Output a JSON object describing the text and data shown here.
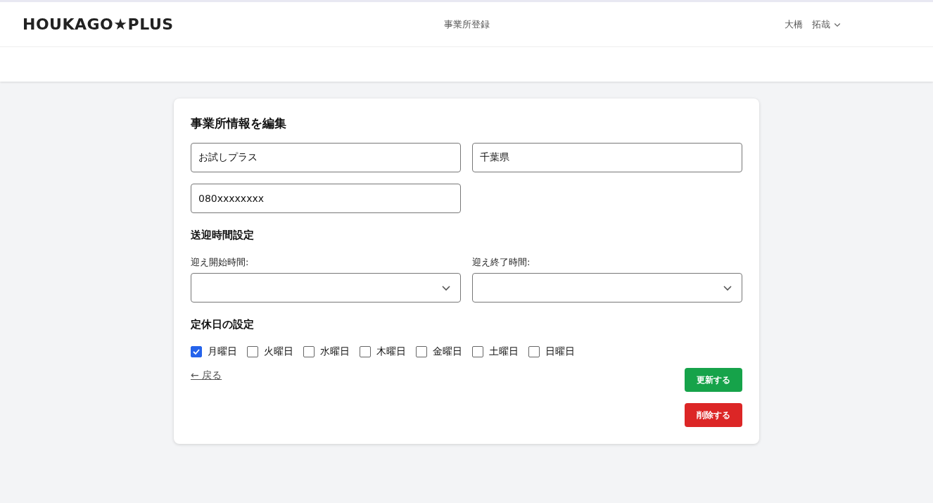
{
  "header": {
    "logo": "HOUKAGO★PLUS",
    "nav_link": "事業所登録",
    "user_name": "大橋　拓哉"
  },
  "form": {
    "title": "事業所情報を編集",
    "fields": [
      {
        "value": "お試しプラス"
      },
      {
        "value": "千葉県"
      },
      {
        "value": "080xxxxxxxx"
      }
    ],
    "pickup_section": "送迎時間設定",
    "selects": [
      {
        "label": "迎え開始時間:"
      },
      {
        "label": "迎え終了時間:"
      }
    ],
    "holiday_section": "定休日の設定",
    "days": [
      {
        "label": "月曜日",
        "checked": true
      },
      {
        "label": "火曜日",
        "checked": false
      },
      {
        "label": "水曜日",
        "checked": false
      },
      {
        "label": "木曜日",
        "checked": false
      },
      {
        "label": "金曜日",
        "checked": false
      },
      {
        "label": "土曜日",
        "checked": false
      },
      {
        "label": "日曜日",
        "checked": false
      }
    ],
    "back_link": "← 戻る",
    "update_button": "更新する",
    "delete_button": "削除する"
  }
}
